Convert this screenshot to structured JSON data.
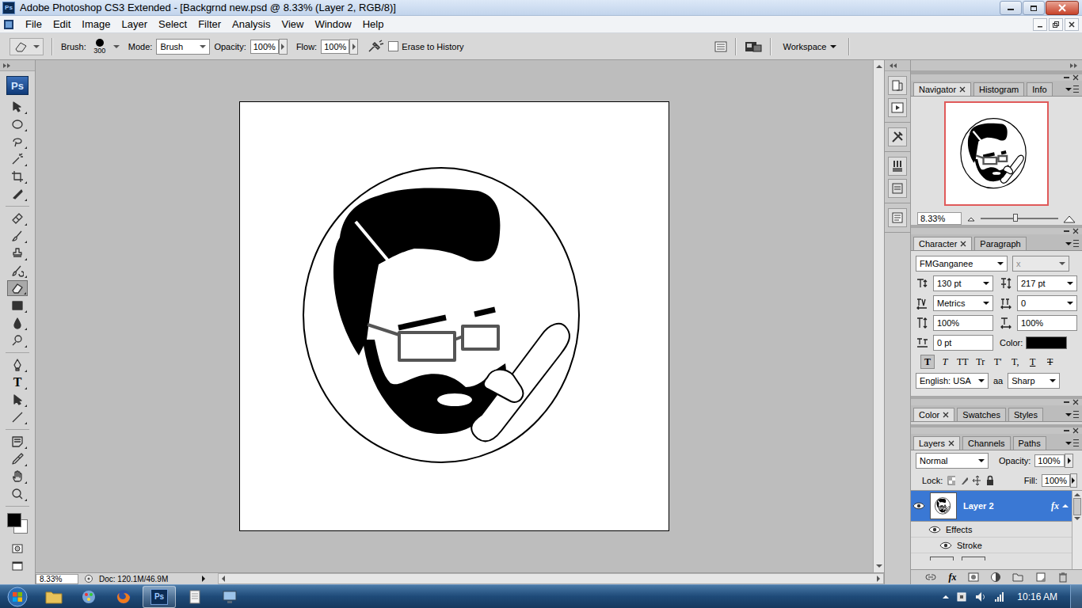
{
  "window": {
    "title": "Adobe Photoshop CS3 Extended - [Backgrnd new.psd @ 8.33% (Layer 2, RGB/8)]",
    "app_icon": "Ps"
  },
  "menu": [
    "File",
    "Edit",
    "Image",
    "Layer",
    "Select",
    "Filter",
    "Analysis",
    "View",
    "Window",
    "Help"
  ],
  "options_bar": {
    "brush_label": "Brush:",
    "brush_size": "300",
    "mode_label": "Mode:",
    "mode": "Brush",
    "opacity_label": "Opacity:",
    "opacity": "100%",
    "flow_label": "Flow:",
    "flow": "100%",
    "erase_to_history": {
      "label": "Erase to History",
      "checked": false
    },
    "workspace": "Workspace"
  },
  "toolbox": {
    "logo": "Ps",
    "tools": [
      {
        "kind": "move",
        "selected": false
      },
      {
        "kind": "marquee",
        "selected": false
      },
      {
        "kind": "lasso",
        "selected": false
      },
      {
        "kind": "wand",
        "selected": false
      },
      {
        "kind": "crop",
        "selected": false
      },
      {
        "kind": "slice",
        "selected": false
      },
      {
        "kind": "healing",
        "selected": false
      },
      {
        "kind": "brush",
        "selected": false
      },
      {
        "kind": "stamp",
        "selected": false
      },
      {
        "kind": "history",
        "selected": false
      },
      {
        "kind": "eraser",
        "selected": true
      },
      {
        "kind": "gradient",
        "selected": false
      },
      {
        "kind": "blur",
        "selected": false
      },
      {
        "kind": "dodge",
        "selected": false
      },
      {
        "kind": "pen",
        "selected": false
      },
      {
        "kind": "type",
        "glyph": "T",
        "selected": false
      },
      {
        "kind": "path-select",
        "selected": false
      },
      {
        "kind": "line",
        "selected": false
      },
      {
        "kind": "notes",
        "selected": false
      },
      {
        "kind": "eyedropper",
        "selected": false
      },
      {
        "kind": "hand",
        "selected": false
      },
      {
        "kind": "zoom",
        "selected": false
      }
    ],
    "foreground": "#000000",
    "background": "#ffffff"
  },
  "status_bar": {
    "zoom": "8.33%",
    "doc": "Doc: 120.1M/46.9M"
  },
  "navigator": {
    "tabs": [
      {
        "label": "Navigator",
        "selected": true
      },
      {
        "label": "Histogram",
        "selected": false
      },
      {
        "label": "Info",
        "selected": false
      }
    ],
    "zoom": "8.33%",
    "zoom_level": 0.45
  },
  "character": {
    "tabs": [
      {
        "label": "Character",
        "selected": true
      },
      {
        "label": "Paragraph",
        "selected": false
      }
    ],
    "font_family": "FMGanganee",
    "font_style": {
      "value": "x",
      "disabled": true
    },
    "fields": [
      {
        "kind": "size",
        "value": "130 pt",
        "dropdown": true
      },
      {
        "kind": "leading",
        "value": "217 pt",
        "dropdown": true
      },
      {
        "kind": "kerning",
        "value": "Metrics",
        "dropdown": true
      },
      {
        "kind": "tracking",
        "value": "0",
        "dropdown": true
      },
      {
        "kind": "vscale",
        "value": "100%",
        "dropdown": false
      },
      {
        "kind": "hscale",
        "value": "100%",
        "dropdown": false
      },
      {
        "kind": "baseline",
        "value": "0 pt",
        "dropdown": false
      }
    ],
    "color_label": "Color:",
    "color": "#000000",
    "style_buttons": [
      {
        "glyph": "T",
        "kind": "bold",
        "selected": true
      },
      {
        "glyph": "T",
        "kind": "italic",
        "selected": false
      },
      {
        "glyph": "TT",
        "kind": "caps",
        "selected": false
      },
      {
        "glyph": "Tr",
        "kind": "smallcaps",
        "selected": false
      },
      {
        "glyph": "T'",
        "kind": "super",
        "selected": false
      },
      {
        "glyph": "T,",
        "kind": "sub",
        "selected": false
      },
      {
        "glyph": "T",
        "kind": "underline",
        "selected": false
      },
      {
        "glyph": "T",
        "kind": "strike",
        "selected": false
      }
    ],
    "language": "English: USA",
    "antialias_glyph": "aa",
    "antialias": "Sharp"
  },
  "color_panel": {
    "tabs": [
      {
        "label": "Color",
        "selected": true
      },
      {
        "label": "Swatches",
        "selected": false
      },
      {
        "label": "Styles",
        "selected": false
      }
    ]
  },
  "layers_panel": {
    "tabs": [
      {
        "label": "Layers",
        "selected": true
      },
      {
        "label": "Channels",
        "selected": false
      },
      {
        "label": "Paths",
        "selected": false
      }
    ],
    "blend_mode": "Normal",
    "opacity_label": "Opacity:",
    "opacity": "100%",
    "lock_label": "Lock:",
    "fill_label": "Fill:",
    "fill": "100%",
    "layers": [
      {
        "name": "Layer 2",
        "visible": true,
        "selected": true,
        "fx": "fx",
        "effects_label": "Effects",
        "effects": [
          {
            "name": "Stroke",
            "visible": true
          }
        ]
      }
    ],
    "fx_button": "fx"
  },
  "taskbar": {
    "apps": [
      {
        "kind": "explorer",
        "active": false
      },
      {
        "kind": "paint",
        "active": false
      },
      {
        "kind": "firefox",
        "active": false
      },
      {
        "kind": "photoshop",
        "label": "Ps",
        "active": true
      },
      {
        "kind": "notepad",
        "active": false
      },
      {
        "kind": "network",
        "active": false
      }
    ],
    "time": "10:16 AM"
  }
}
